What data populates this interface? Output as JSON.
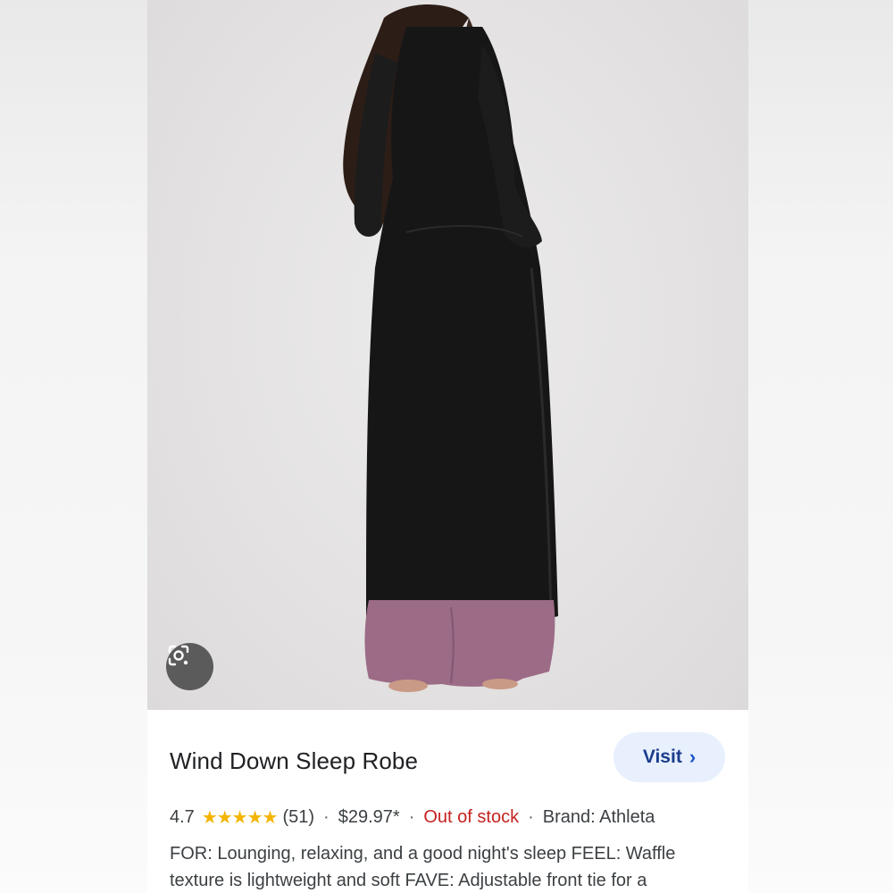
{
  "product": {
    "title": "Wind Down Sleep Robe",
    "visit_label": "Visit",
    "visit_chevron": "›",
    "rating": "4.7",
    "stars": "★★★★★",
    "review_count": "(51)",
    "price": "$29.97*",
    "stock_status": "Out of stock",
    "brand": "Brand: Athleta",
    "separator": "·",
    "description": "FOR: Lounging, relaxing, and a good night's sleep FEEL: Waffle texture is lightweight and soft FAVE: Adjustable front tie for a"
  },
  "icons": {
    "lens": "lens-search-icon",
    "chevron": "chevron-right-icon",
    "star": "star-icon"
  },
  "colors": {
    "visit_bg": "#e8f0fe",
    "visit_text": "#1a3c8c",
    "star": "#f4b400",
    "out_of_stock": "#c5221f"
  }
}
